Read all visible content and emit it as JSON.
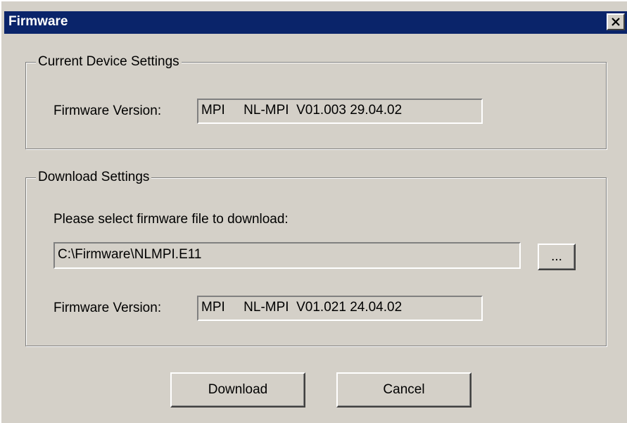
{
  "window": {
    "title": "Firmware",
    "close_icon": "close-x-icon"
  },
  "current_device": {
    "group_label": "Current Device Settings",
    "firmware_version_label": "Firmware Version:",
    "firmware_version_value": "MPI     NL-MPI  V01.003 29.04.02"
  },
  "download_settings": {
    "group_label": "Download Settings",
    "prompt": "Please select firmware file to download:",
    "file_path": "C:\\Firmware\\NLMPI.E11",
    "browse_label": "...",
    "firmware_version_label": "Firmware Version:",
    "firmware_version_value": "MPI     NL-MPI  V01.021 24.04.02"
  },
  "buttons": {
    "download_label": "Download",
    "cancel_label": "Cancel"
  }
}
